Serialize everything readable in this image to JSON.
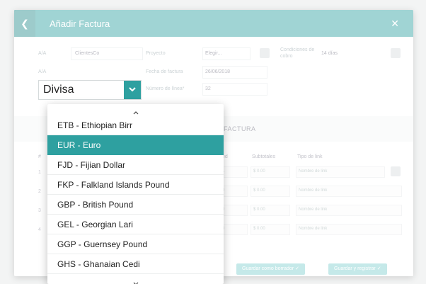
{
  "modal": {
    "title": "Añadir Factura",
    "back_icon": "chevron-left-icon",
    "close_icon": "close-icon"
  },
  "form": {
    "field1_label": "A/A",
    "field1_value": "ClientesCo",
    "field2_label": "A/A",
    "proyecto_label": "Proyecto",
    "proyecto_value": "Elegir...",
    "fecha_label": "Fecha de factura",
    "fecha_value": "26/06/2018",
    "numero_label": "Número de línea*",
    "numero_value": "32",
    "condiciones_label": "Condiciones de cobro",
    "condiciones_value": "14 días"
  },
  "divisa": {
    "label": "Divisa"
  },
  "section": {
    "title": "FACTURA"
  },
  "table": {
    "headers": [
      "#",
      "ed",
      "Subtotales",
      "Tipo de link"
    ],
    "rows": [
      {
        "num": "1",
        "qty": "1",
        "sub": "$ 0.00",
        "link": "Nombre de link"
      },
      {
        "num": "2",
        "qty": "0",
        "sub": "$ 0.00",
        "link": "Nombre de link"
      },
      {
        "num": "3",
        "qty": "0",
        "sub": "$ 0.00",
        "link": "Nombre de link"
      },
      {
        "num": "4",
        "qty": "0",
        "sub": "$ 0.00",
        "link": "Nombre de link"
      }
    ]
  },
  "footer": {
    "save_draft": "Guardar como borrador",
    "save_register": "Guardar y registrar"
  },
  "dropdown": {
    "selected": "EUR - Euro",
    "options": [
      "ETB - Ethiopian Birr",
      "EUR - Euro",
      "FJD - Fijian Dollar",
      "FKP - Falkland Islands Pound",
      "GBP - British Pound",
      "GEL - Georgian Lari",
      "GGP - Guernsey Pound",
      "GHS - Ghanaian Cedi"
    ]
  },
  "colors": {
    "accent": "#2ea0a0",
    "accent_dark": "#278c8c"
  }
}
